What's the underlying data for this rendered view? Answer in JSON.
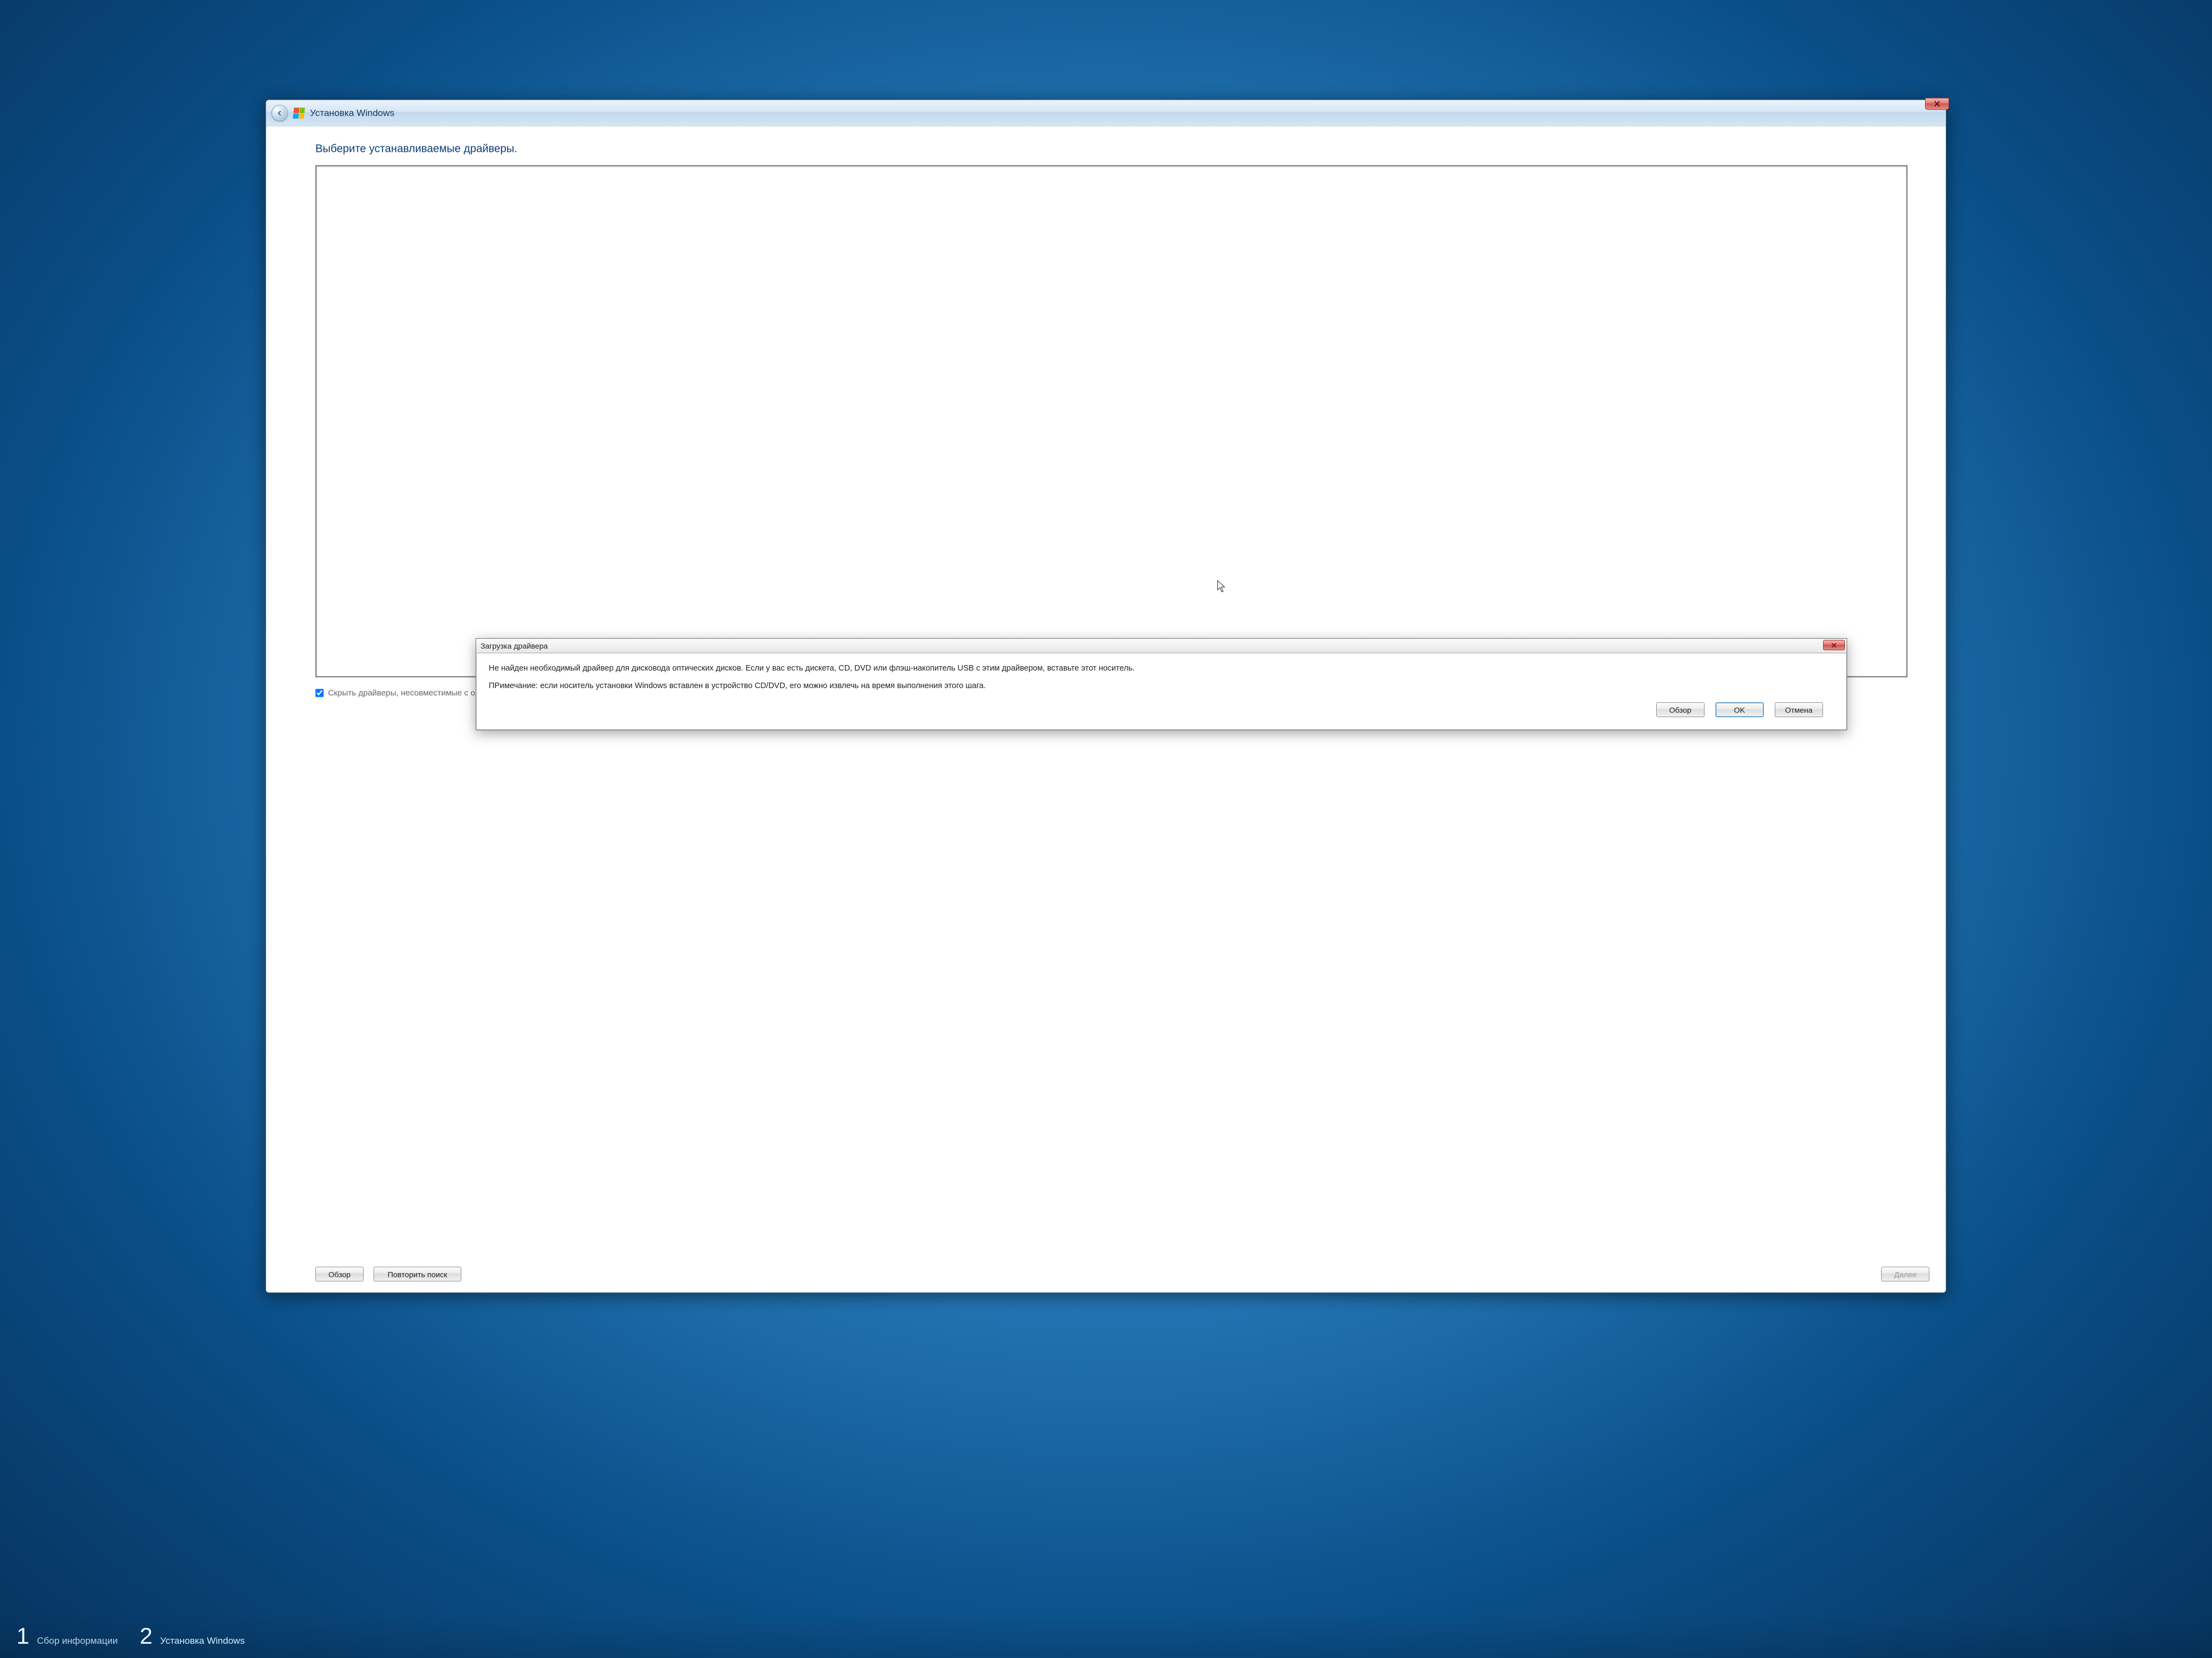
{
  "wizard": {
    "title": "Установка Windows",
    "instruction": "Выберите устанавливаемые драйверы.",
    "hide_incompatible_label": "Скрыть драйверы, несовместимые с оборудованием компьютера.",
    "browse_label": "Обзор",
    "rescan_label": "Повторить поиск",
    "next_label": "Далее"
  },
  "dialog": {
    "title": "Загрузка драйвера",
    "message1": "Не найден необходимый драйвер для дисковода оптических дисков. Если у вас есть дискета, CD, DVD или флэш-накопитель USB с этим драйвером, вставьте этот носитель.",
    "message2": "ПРимечание: если носитель установки Windows вставлен в устройство CD/DVD, его можно извлечь на время выполнения этого шага.",
    "browse_label": "Обзор",
    "ok_label": "OK",
    "cancel_label": "Отмена"
  },
  "steps": {
    "step1_num": "1",
    "step1_label": "Сбор информации",
    "step2_num": "2",
    "step2_label": "Установка Windows"
  }
}
